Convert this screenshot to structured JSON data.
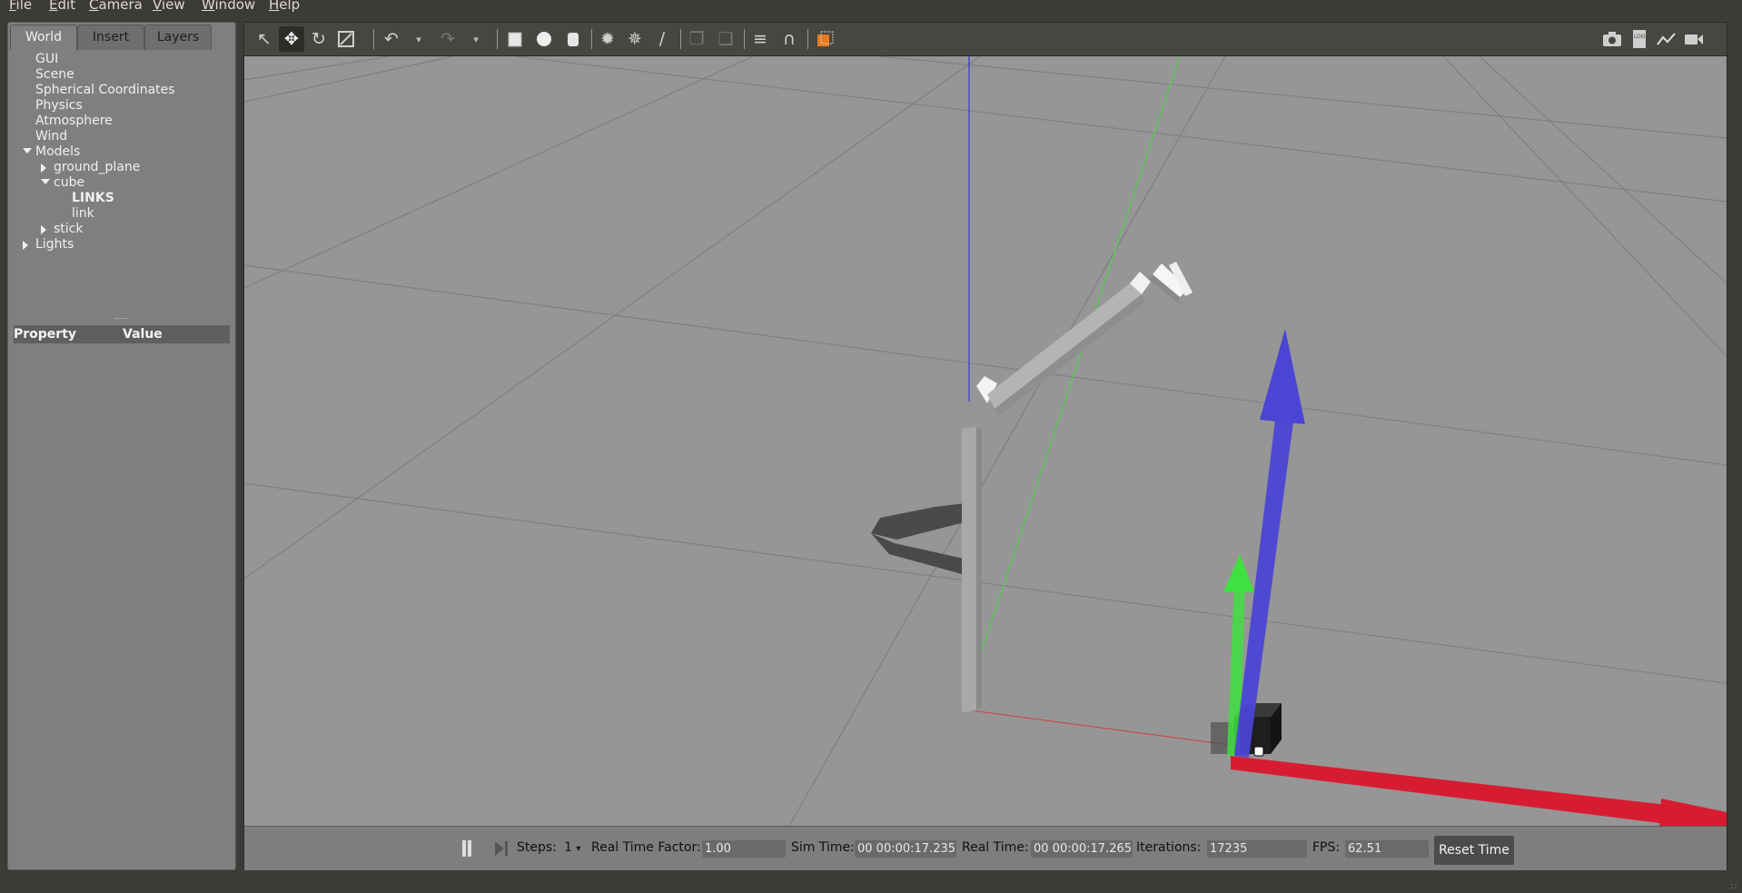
{
  "menu": [
    "File",
    "Edit",
    "Camera",
    "View",
    "Window",
    "Help"
  ],
  "tabs": [
    "World",
    "Insert",
    "Layers"
  ],
  "tree": [
    {
      "label": "GUI",
      "indent": 0,
      "expander": "none",
      "bold": false
    },
    {
      "label": "Scene",
      "indent": 0,
      "expander": "none",
      "bold": false
    },
    {
      "label": "Spherical Coordinates",
      "indent": 0,
      "expander": "none",
      "bold": false
    },
    {
      "label": "Physics",
      "indent": 0,
      "expander": "none",
      "bold": false
    },
    {
      "label": "Atmosphere",
      "indent": 0,
      "expander": "none",
      "bold": false
    },
    {
      "label": "Wind",
      "indent": 0,
      "expander": "none",
      "bold": false
    },
    {
      "label": "Models",
      "indent": 0,
      "expander": "expanded",
      "bold": false
    },
    {
      "label": "ground_plane",
      "indent": 1,
      "expander": "collapsed",
      "bold": false
    },
    {
      "label": "cube",
      "indent": 1,
      "expander": "expanded",
      "bold": false
    },
    {
      "label": "LINKS",
      "indent": 2,
      "expander": "none",
      "bold": true
    },
    {
      "label": "link",
      "indent": 2,
      "expander": "none",
      "bold": false
    },
    {
      "label": "stick",
      "indent": 1,
      "expander": "collapsed",
      "bold": false
    },
    {
      "label": "Lights",
      "indent": 0,
      "expander": "collapsed",
      "bold": false
    }
  ],
  "properties": {
    "col_property": "Property",
    "col_value": "Value"
  },
  "toolbar": {
    "left_tools": [
      "select-arrow-icon",
      "translate-icon",
      "rotate-icon",
      "scale-icon",
      "undo-icon",
      "redo-icon",
      "box-icon",
      "sphere-icon",
      "cylinder-icon",
      "point-light-icon",
      "spot-light-icon",
      "directional-light-icon",
      "copy-icon",
      "paste-icon",
      "align-icon",
      "snap-magnet-icon",
      "view-angle-icon"
    ],
    "right_tools": [
      "screenshot-icon",
      "log-icon",
      "plot-icon",
      "video-icon"
    ],
    "active_tool": "translate-icon"
  },
  "status": {
    "steps_label": "Steps:",
    "steps_value": "1",
    "rtf_label": "Real Time Factor:",
    "rtf_value": "1.00",
    "sim_time_label": "Sim Time:",
    "sim_time_value": "00 00:00:17.235",
    "real_time_label": "Real Time:",
    "real_time_value": "00 00:00:17.265",
    "iterations_label": "Iterations:",
    "iterations_value": "17235",
    "fps_label": "FPS:",
    "fps_value": "62.51",
    "reset_label": "Reset Time"
  },
  "colors": {
    "viewport_bg": "#969696",
    "axis_x": "#d81c30",
    "axis_y": "#3fe03f",
    "axis_z": "#4a45d4",
    "cube": "#1e1e1e"
  }
}
